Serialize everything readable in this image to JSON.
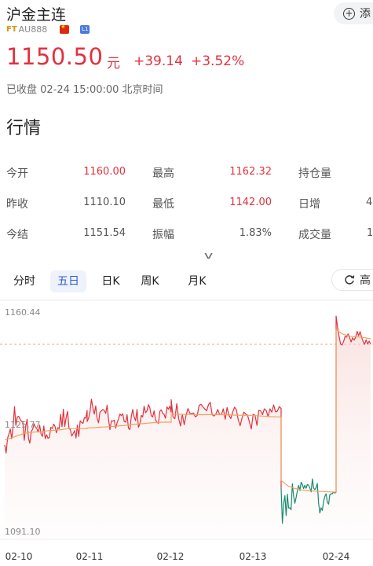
{
  "header": {
    "title": "沪金主连",
    "source_badge": "FT",
    "code": "AU888",
    "level_badge": "L1",
    "add_button_label": "添"
  },
  "quote": {
    "price": "1150.50",
    "unit": "元",
    "change": "+39.14",
    "change_pct": "+3.52%",
    "status": "已收盘 02-24 15:00:00 北京时间"
  },
  "section_title": "行情",
  "stats": {
    "rows": [
      [
        {
          "label": "今开",
          "value": "1160.00"
        },
        {
          "label": "最高",
          "value": "1162.32"
        },
        {
          "label": "持仓量",
          "value": ""
        }
      ],
      [
        {
          "label": "昨收",
          "value": "1110.10"
        },
        {
          "label": "最低",
          "value": "1142.00"
        },
        {
          "label": "日增",
          "value": "4"
        }
      ],
      [
        {
          "label": "今结",
          "value": "1151.54"
        },
        {
          "label": "振幅",
          "value": "1.83%"
        },
        {
          "label": "成交量",
          "value": "1"
        }
      ]
    ]
  },
  "tabs": [
    "分时",
    "五日",
    "日K",
    "周K",
    "月K"
  ],
  "active_tab": "五日",
  "tool_button_label": "高",
  "colors": {
    "up": "#e0323e",
    "down": "#1a8a6e",
    "avg": "#f0a060",
    "ref": "#f2a19a",
    "active_tab": "#2f5bd1"
  },
  "chart_data": {
    "type": "line",
    "title": "",
    "y_ticks": [
      "1160.44",
      "1125.77",
      "1091.10"
    ],
    "ylim": [
      1091.1,
      1160.44
    ],
    "reference_line": 1150.5,
    "x_ticks": [
      "02-10",
      "02-11",
      "02-12",
      "02-13",
      "02-24"
    ],
    "series": [
      {
        "values_by_day": [
          [
            1119.5,
            1117.0,
            1121.5,
            1122.8,
            1124.4,
            1121.4,
            1125.2,
            1131.3,
            1125.5,
            1128.1,
            1128.3,
            1127.4,
            1126.7,
            1126.8,
            1120.9,
            1125.0,
            1127.4,
            1121.4,
            1120.0,
            1123.6,
            1124.4,
            1126.0,
            1124.9,
            1124.5,
            1123.4,
            1125.6,
            1122.8,
            1122.1,
            1125.3,
            1121.4,
            1122.6,
            1121.5,
            1121.8,
            1124.9,
            1124.5,
            1125.9,
            1125.2,
            1123.2,
            1124.8,
            1124.5,
            1128.9,
            1125.1,
            1130.5,
            1125.2,
            1128.0,
            1129.8,
            1124.5,
            1124.2,
            1122.2,
            1123.0,
            1123.9,
            1121.6,
            1125.6,
            1122.1,
            1126.9,
            1126.4,
            1126.1,
            1127.9,
            1127.7,
            1130.1
          ],
          [
            1126.7,
            1127.7,
            1129.6,
            1133.6,
            1130.9,
            1129.0,
            1131.5,
            1127.7,
            1126.3,
            1129.6,
            1130.0,
            1130.4,
            1130.1,
            1129.2,
            1131.7,
            1127.4,
            1124.2,
            1126.9,
            1126.8,
            1127.1,
            1124.6,
            1126.3,
            1127.5,
            1129.0,
            1128.5,
            1129.1,
            1126.7,
            1126.5,
            1128.8,
            1124.6,
            1124.2,
            1128.2,
            1130.4,
            1128.1,
            1126.9,
            1130.4,
            1124.9,
            1126.0,
            1128.6,
            1128.1,
            1131.4,
            1129.4,
            1130.0,
            1131.9,
            1130.9,
            1128.5,
            1128.1,
            1130.0,
            1127.2,
            1126.5,
            1126.1,
            1129.8,
            1130.3,
            1129.3,
            1128.9,
            1127.7,
            1131.2,
            1130.5,
            1131.4,
            1129.5
          ],
          [
            1133.4,
            1128.0,
            1127.6,
            1132.2,
            1127.6,
            1125.3,
            1128.9,
            1125.7,
            1128.7,
            1130.7,
            1129.3,
            1129.1,
            1129.3,
            1128.1,
            1128.6,
            1131.7,
            1132.0,
            1131.3,
            1130.6,
            1130.0,
            1131.9,
            1132.6,
            1128.8,
            1128.4,
            1129.0,
            1130.4,
            1128.8,
            1128.9,
            1130.6,
            1127.4,
            1131.0,
            1128.6,
            1127.6,
            1129.6,
            1131.1,
            1130.3,
            1127.2,
            1125.4,
            1127.8,
            1129.6,
            1129.0,
            1128.6,
            1126.5,
            1124.4,
            1128.9,
            1128.6,
            1125.5,
            1130.1,
            1130.0,
            1128.8,
            1130.6,
            1130.1,
            1128.2,
            1130.6,
            1129.6,
            1131.8,
            1129.7,
            1129.9,
            1131.3,
            1130.7
          ],
          [
            1106.2,
            1095.3,
            1101.4,
            1103.8,
            1097.7,
            1104.3,
            1100.0,
            1100.1,
            1099.5,
            1107.5,
            1103.7,
            1101.5,
            1103.3,
            1105.3,
            1107.0,
            1105.4,
            1108.0,
            1107.3,
            1106.0,
            1107.0,
            1106.1,
            1107.3,
            1107.0,
            1106.2,
            1105.0,
            1109.0,
            1106.1,
            1105.7,
            1106.3,
            1107.6,
            1101.6,
            1098.5,
            1100.1,
            1099.3,
            1102.1,
            1103.6,
            1104.4,
            1101.8,
            1101.2,
            1104.1,
            1104.4,
            1104.4,
            1105.0,
            1104.6,
            1104.9
          ],
          [
            1159.2,
            1155.8,
            1153.0,
            1150.6,
            1150.3,
            1151.4,
            1153.0,
            1152.7,
            1153.7,
            1152.6,
            1151.2,
            1152.5,
            1151.8,
            1152.7,
            1154.5,
            1153.2,
            1154.4,
            1152.7,
            1151.4,
            1150.5,
            1151.9,
            1150.6,
            1151.5,
            1150.6
          ]
        ]
      },
      {
        "name": "",
        "values_by_day": [
          [
            1121.0,
            1121.6,
            1122.3,
            1123.0,
            1123.3,
            1123.5,
            1123.6,
            1123.9,
            1124.0,
            1124.2,
            1124.5,
            1124.5,
            1124.5,
            1124.5
          ],
          [
            1124.7,
            1124.8,
            1125.0,
            1125.1,
            1125.3,
            1125.5,
            1125.8,
            1126.0,
            1126.2,
            1126.4,
            1126.5,
            1126.5
          ],
          [
            1129.0,
            1128.9,
            1128.9,
            1128.8,
            1128.8,
            1128.8,
            1128.7,
            1128.6,
            1128.6,
            1128.4,
            1128.2,
            1128.1
          ],
          [
            1108.5,
            1106.8,
            1106.0,
            1105.6,
            1105.4,
            1105.2,
            1105.1,
            1105.0,
            1104.9
          ],
          [
            1155.0,
            1153.6,
            1153.0,
            1152.8,
            1152.6,
            1152.2
          ]
        ]
      }
    ]
  }
}
